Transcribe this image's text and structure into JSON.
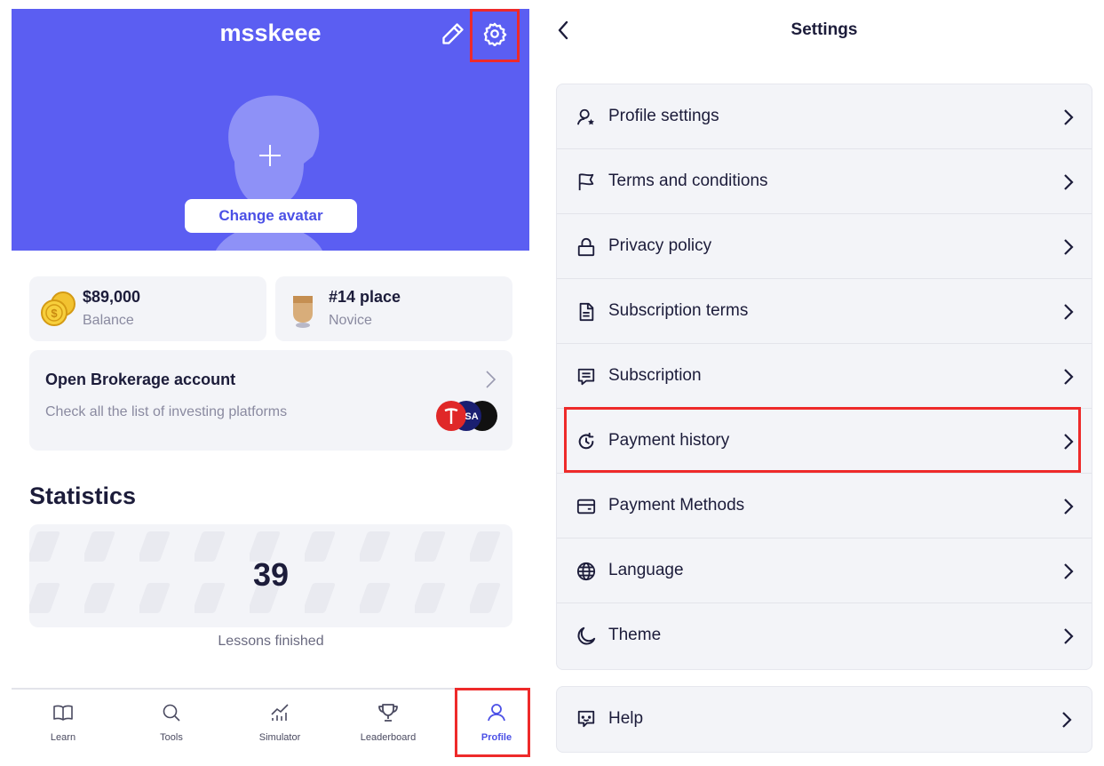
{
  "profile": {
    "username": "msskeee",
    "change_avatar_label": "Change avatar"
  },
  "balance": {
    "value": "$89,000",
    "label": "Balance"
  },
  "rank": {
    "value": "#14 place",
    "label": "Novice"
  },
  "broker": {
    "title": "Open Brokerage account",
    "subtitle": "Check all the list of investing platforms",
    "logo_text": "SA"
  },
  "statistics": {
    "title": "Statistics",
    "lessons_count": "39",
    "lessons_label": "Lessons finished"
  },
  "tabbar": {
    "tabs": [
      {
        "label": "Learn",
        "icon": "book-icon"
      },
      {
        "label": "Tools",
        "icon": "search-icon"
      },
      {
        "label": "Simulator",
        "icon": "chart-icon"
      },
      {
        "label": "Leaderboard",
        "icon": "trophy-icon"
      },
      {
        "label": "Profile",
        "icon": "user-icon",
        "active": true
      }
    ]
  },
  "settings": {
    "title": "Settings",
    "items": [
      {
        "label": "Profile settings",
        "icon": "user-star-icon"
      },
      {
        "label": "Terms and conditions",
        "icon": "flag-icon"
      },
      {
        "label": "Privacy policy",
        "icon": "lock-icon"
      },
      {
        "label": "Subscription terms",
        "icon": "document-icon"
      },
      {
        "label": "Subscription",
        "icon": "receipt-icon"
      },
      {
        "label": "Payment history",
        "icon": "history-icon"
      },
      {
        "label": "Payment Methods",
        "icon": "card-icon"
      },
      {
        "label": "Language",
        "icon": "globe-icon"
      },
      {
        "label": "Theme",
        "icon": "moon-icon"
      }
    ],
    "help": {
      "label": "Help",
      "icon": "chat-icon"
    }
  },
  "colors": {
    "accent": "#5b5ef2",
    "accent_text": "#4b50e6",
    "highlight": "#ee2a2a",
    "card_bg": "#f3f4f8"
  }
}
